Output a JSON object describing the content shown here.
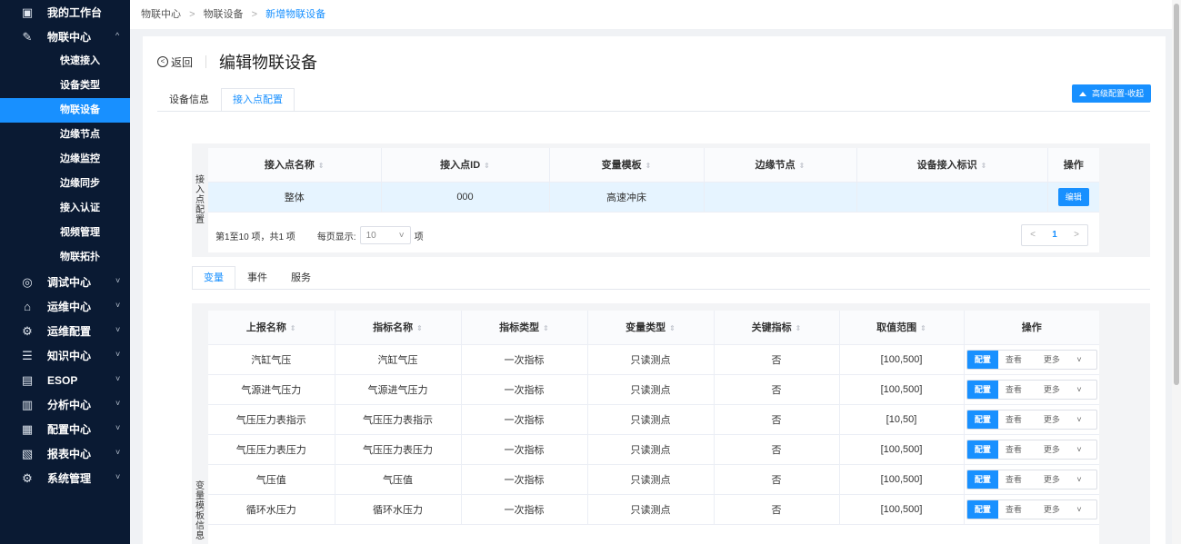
{
  "sidebar": {
    "items": [
      {
        "icon": "workbench-icon",
        "glyph": "▣",
        "label": "我的工作台",
        "arrow": ""
      },
      {
        "icon": "iot-icon",
        "glyph": "✎",
        "label": "物联中心",
        "arrow": "^"
      },
      {
        "icon": "debug-icon",
        "glyph": "◎",
        "label": "调试中心",
        "arrow": "˅"
      },
      {
        "icon": "ops-icon",
        "glyph": "⌂",
        "label": "运维中心",
        "arrow": "˅"
      },
      {
        "icon": "ops-config-icon",
        "glyph": "⚙",
        "label": "运维配置",
        "arrow": "˅"
      },
      {
        "icon": "knowledge-icon",
        "glyph": "☰",
        "label": "知识中心",
        "arrow": "˅"
      },
      {
        "icon": "esop-icon",
        "glyph": "▤",
        "label": "ESOP",
        "arrow": "˅"
      },
      {
        "icon": "analysis-icon",
        "glyph": "▥",
        "label": "分析中心",
        "arrow": "˅"
      },
      {
        "icon": "config-center-icon",
        "glyph": "▦",
        "label": "配置中心",
        "arrow": "˅"
      },
      {
        "icon": "report-icon",
        "glyph": "▧",
        "label": "报表中心",
        "arrow": "˅"
      },
      {
        "icon": "system-icon",
        "glyph": "⚙",
        "label": "系统管理",
        "arrow": "˅"
      }
    ],
    "sub_items": [
      "快速接入",
      "设备类型",
      "物联设备",
      "边缘节点",
      "边缘监控",
      "边缘同步",
      "接入认证",
      "视频管理",
      "物联拓扑"
    ]
  },
  "breadcrumb": {
    "b1": "物联中心",
    "b2": "物联设备",
    "b3": "新增物联设备",
    "sep": ">"
  },
  "header": {
    "back_label": "返回",
    "back_glyph": "⊖",
    "title": "编辑物联设备",
    "adv_button": "高级配置-收起"
  },
  "tabs": {
    "t1": "设备信息",
    "t2": "接入点配置"
  },
  "access_section": {
    "label": "接入点配置",
    "headers": [
      "接入点名称",
      "接入点ID",
      "变量模板",
      "边缘节点",
      "设备接入标识",
      "操作"
    ],
    "row": {
      "name": "整体",
      "id": "000",
      "template": "高速冲床",
      "edge": "",
      "ident": "",
      "action": "编辑"
    },
    "pager": {
      "summary": "第1至10 项，共1 项",
      "per_page_label": "每页显示:",
      "per_page_value": "10",
      "unit": "项",
      "current": "1",
      "prev": "<",
      "next": ">"
    }
  },
  "tabs2": {
    "t1": "变量",
    "t2": "事件",
    "t3": "服务"
  },
  "var_section": {
    "label": "变量模板信息",
    "headers": [
      "上报名称",
      "指标名称",
      "指标类型",
      "变量类型",
      "关键指标",
      "取值范围",
      "操作"
    ],
    "actions": {
      "config": "配置",
      "view": "查看",
      "more": "更多"
    },
    "rows": [
      {
        "report": "汽缸气压",
        "metric": "汽缸气压",
        "mtype": "一次指标",
        "vtype": "只读测点",
        "key": "否",
        "range": "[100,500]"
      },
      {
        "report": "气源进气压力",
        "metric": "气源进气压力",
        "mtype": "一次指标",
        "vtype": "只读测点",
        "key": "否",
        "range": "[100,500]"
      },
      {
        "report": "气压压力表指示",
        "metric": "气压压力表指示",
        "mtype": "一次指标",
        "vtype": "只读测点",
        "key": "否",
        "range": "[10,50]"
      },
      {
        "report": "气压压力表压力",
        "metric": "气压压力表压力",
        "mtype": "一次指标",
        "vtype": "只读测点",
        "key": "否",
        "range": "[100,500]"
      },
      {
        "report": "气压值",
        "metric": "气压值",
        "mtype": "一次指标",
        "vtype": "只读测点",
        "key": "否",
        "range": "[100,500]"
      },
      {
        "report": "循环水压力",
        "metric": "循环水压力",
        "mtype": "一次指标",
        "vtype": "只读测点",
        "key": "否",
        "range": "[100,500]"
      }
    ]
  },
  "colors": {
    "accent": "#1890ff",
    "sidebar_bg": "#0a1a33"
  }
}
